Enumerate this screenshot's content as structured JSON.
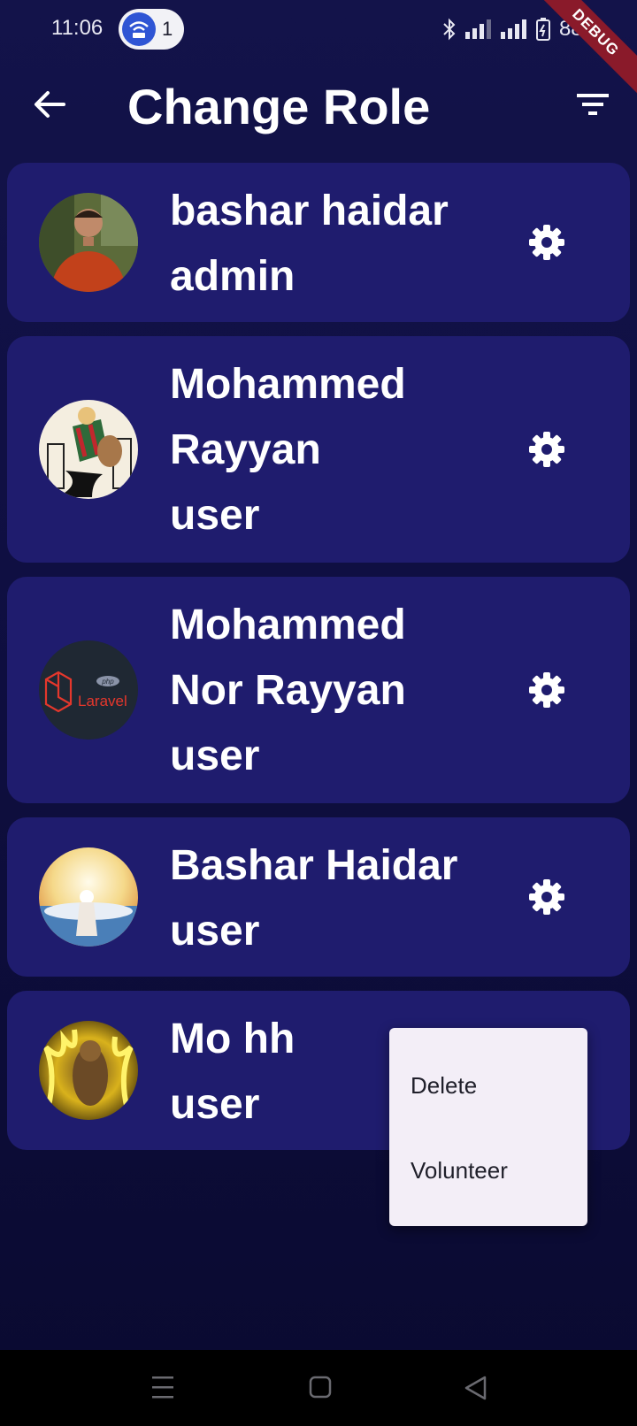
{
  "status": {
    "time": "11:06",
    "hotspot_count": "1",
    "battery": "88%"
  },
  "debug_banner": "DEBUG",
  "header": {
    "title": "Change Role",
    "back_icon": "arrow-left-icon",
    "filter_icon": "filter-list-icon"
  },
  "users": [
    {
      "name_line1": "bashar haidar",
      "name_line2": "",
      "role": "admin"
    },
    {
      "name_line1": "Mohammed",
      "name_line2": "Rayyan",
      "role": "user"
    },
    {
      "name_line1": "Mohammed",
      "name_line2": "Nor Rayyan",
      "role": "user"
    },
    {
      "name_line1": "Bashar Haidar",
      "name_line2": "",
      "role": "user"
    },
    {
      "name_line1": "Mo hh",
      "name_line2": "",
      "role": "user"
    }
  ],
  "avatar_texts": {
    "laravel": "Laravel",
    "php": "php"
  },
  "popup_menu": {
    "items": [
      "Delete",
      "Volunteer"
    ]
  },
  "colors": {
    "background": "#13134a",
    "card": "#1f1c6e",
    "popup": "#f3eef7",
    "debug": "#8a1a2a"
  }
}
